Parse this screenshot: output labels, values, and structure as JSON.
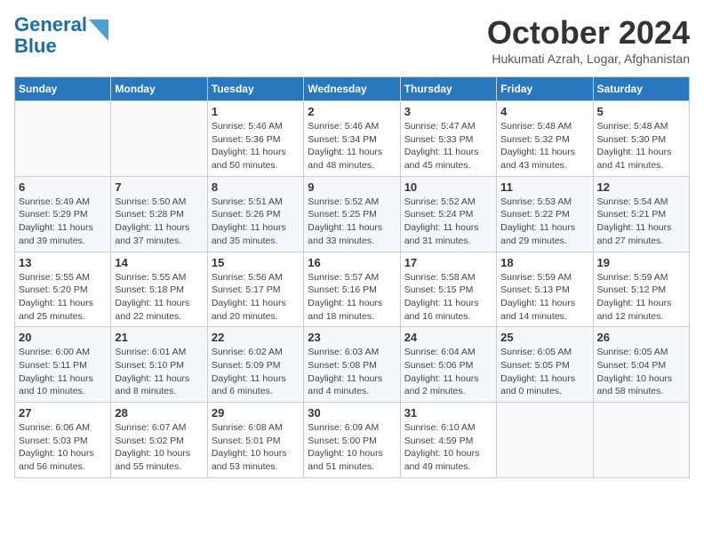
{
  "header": {
    "logo_line1": "General",
    "logo_line2": "Blue",
    "month": "October 2024",
    "location": "Hukumati Azrah, Logar, Afghanistan"
  },
  "weekdays": [
    "Sunday",
    "Monday",
    "Tuesday",
    "Wednesday",
    "Thursday",
    "Friday",
    "Saturday"
  ],
  "weeks": [
    [
      {
        "day": "",
        "info": ""
      },
      {
        "day": "",
        "info": ""
      },
      {
        "day": "1",
        "info": "Sunrise: 5:46 AM\nSunset: 5:36 PM\nDaylight: 11 hours\nand 50 minutes."
      },
      {
        "day": "2",
        "info": "Sunrise: 5:46 AM\nSunset: 5:34 PM\nDaylight: 11 hours\nand 48 minutes."
      },
      {
        "day": "3",
        "info": "Sunrise: 5:47 AM\nSunset: 5:33 PM\nDaylight: 11 hours\nand 45 minutes."
      },
      {
        "day": "4",
        "info": "Sunrise: 5:48 AM\nSunset: 5:32 PM\nDaylight: 11 hours\nand 43 minutes."
      },
      {
        "day": "5",
        "info": "Sunrise: 5:48 AM\nSunset: 5:30 PM\nDaylight: 11 hours\nand 41 minutes."
      }
    ],
    [
      {
        "day": "6",
        "info": "Sunrise: 5:49 AM\nSunset: 5:29 PM\nDaylight: 11 hours\nand 39 minutes."
      },
      {
        "day": "7",
        "info": "Sunrise: 5:50 AM\nSunset: 5:28 PM\nDaylight: 11 hours\nand 37 minutes."
      },
      {
        "day": "8",
        "info": "Sunrise: 5:51 AM\nSunset: 5:26 PM\nDaylight: 11 hours\nand 35 minutes."
      },
      {
        "day": "9",
        "info": "Sunrise: 5:52 AM\nSunset: 5:25 PM\nDaylight: 11 hours\nand 33 minutes."
      },
      {
        "day": "10",
        "info": "Sunrise: 5:52 AM\nSunset: 5:24 PM\nDaylight: 11 hours\nand 31 minutes."
      },
      {
        "day": "11",
        "info": "Sunrise: 5:53 AM\nSunset: 5:22 PM\nDaylight: 11 hours\nand 29 minutes."
      },
      {
        "day": "12",
        "info": "Sunrise: 5:54 AM\nSunset: 5:21 PM\nDaylight: 11 hours\nand 27 minutes."
      }
    ],
    [
      {
        "day": "13",
        "info": "Sunrise: 5:55 AM\nSunset: 5:20 PM\nDaylight: 11 hours\nand 25 minutes."
      },
      {
        "day": "14",
        "info": "Sunrise: 5:55 AM\nSunset: 5:18 PM\nDaylight: 11 hours\nand 22 minutes."
      },
      {
        "day": "15",
        "info": "Sunrise: 5:56 AM\nSunset: 5:17 PM\nDaylight: 11 hours\nand 20 minutes."
      },
      {
        "day": "16",
        "info": "Sunrise: 5:57 AM\nSunset: 5:16 PM\nDaylight: 11 hours\nand 18 minutes."
      },
      {
        "day": "17",
        "info": "Sunrise: 5:58 AM\nSunset: 5:15 PM\nDaylight: 11 hours\nand 16 minutes."
      },
      {
        "day": "18",
        "info": "Sunrise: 5:59 AM\nSunset: 5:13 PM\nDaylight: 11 hours\nand 14 minutes."
      },
      {
        "day": "19",
        "info": "Sunrise: 5:59 AM\nSunset: 5:12 PM\nDaylight: 11 hours\nand 12 minutes."
      }
    ],
    [
      {
        "day": "20",
        "info": "Sunrise: 6:00 AM\nSunset: 5:11 PM\nDaylight: 11 hours\nand 10 minutes."
      },
      {
        "day": "21",
        "info": "Sunrise: 6:01 AM\nSunset: 5:10 PM\nDaylight: 11 hours\nand 8 minutes."
      },
      {
        "day": "22",
        "info": "Sunrise: 6:02 AM\nSunset: 5:09 PM\nDaylight: 11 hours\nand 6 minutes."
      },
      {
        "day": "23",
        "info": "Sunrise: 6:03 AM\nSunset: 5:08 PM\nDaylight: 11 hours\nand 4 minutes."
      },
      {
        "day": "24",
        "info": "Sunrise: 6:04 AM\nSunset: 5:06 PM\nDaylight: 11 hours\nand 2 minutes."
      },
      {
        "day": "25",
        "info": "Sunrise: 6:05 AM\nSunset: 5:05 PM\nDaylight: 11 hours\nand 0 minutes."
      },
      {
        "day": "26",
        "info": "Sunrise: 6:05 AM\nSunset: 5:04 PM\nDaylight: 10 hours\nand 58 minutes."
      }
    ],
    [
      {
        "day": "27",
        "info": "Sunrise: 6:06 AM\nSunset: 5:03 PM\nDaylight: 10 hours\nand 56 minutes."
      },
      {
        "day": "28",
        "info": "Sunrise: 6:07 AM\nSunset: 5:02 PM\nDaylight: 10 hours\nand 55 minutes."
      },
      {
        "day": "29",
        "info": "Sunrise: 6:08 AM\nSunset: 5:01 PM\nDaylight: 10 hours\nand 53 minutes."
      },
      {
        "day": "30",
        "info": "Sunrise: 6:09 AM\nSunset: 5:00 PM\nDaylight: 10 hours\nand 51 minutes."
      },
      {
        "day": "31",
        "info": "Sunrise: 6:10 AM\nSunset: 4:59 PM\nDaylight: 10 hours\nand 49 minutes."
      },
      {
        "day": "",
        "info": ""
      },
      {
        "day": "",
        "info": ""
      }
    ]
  ]
}
